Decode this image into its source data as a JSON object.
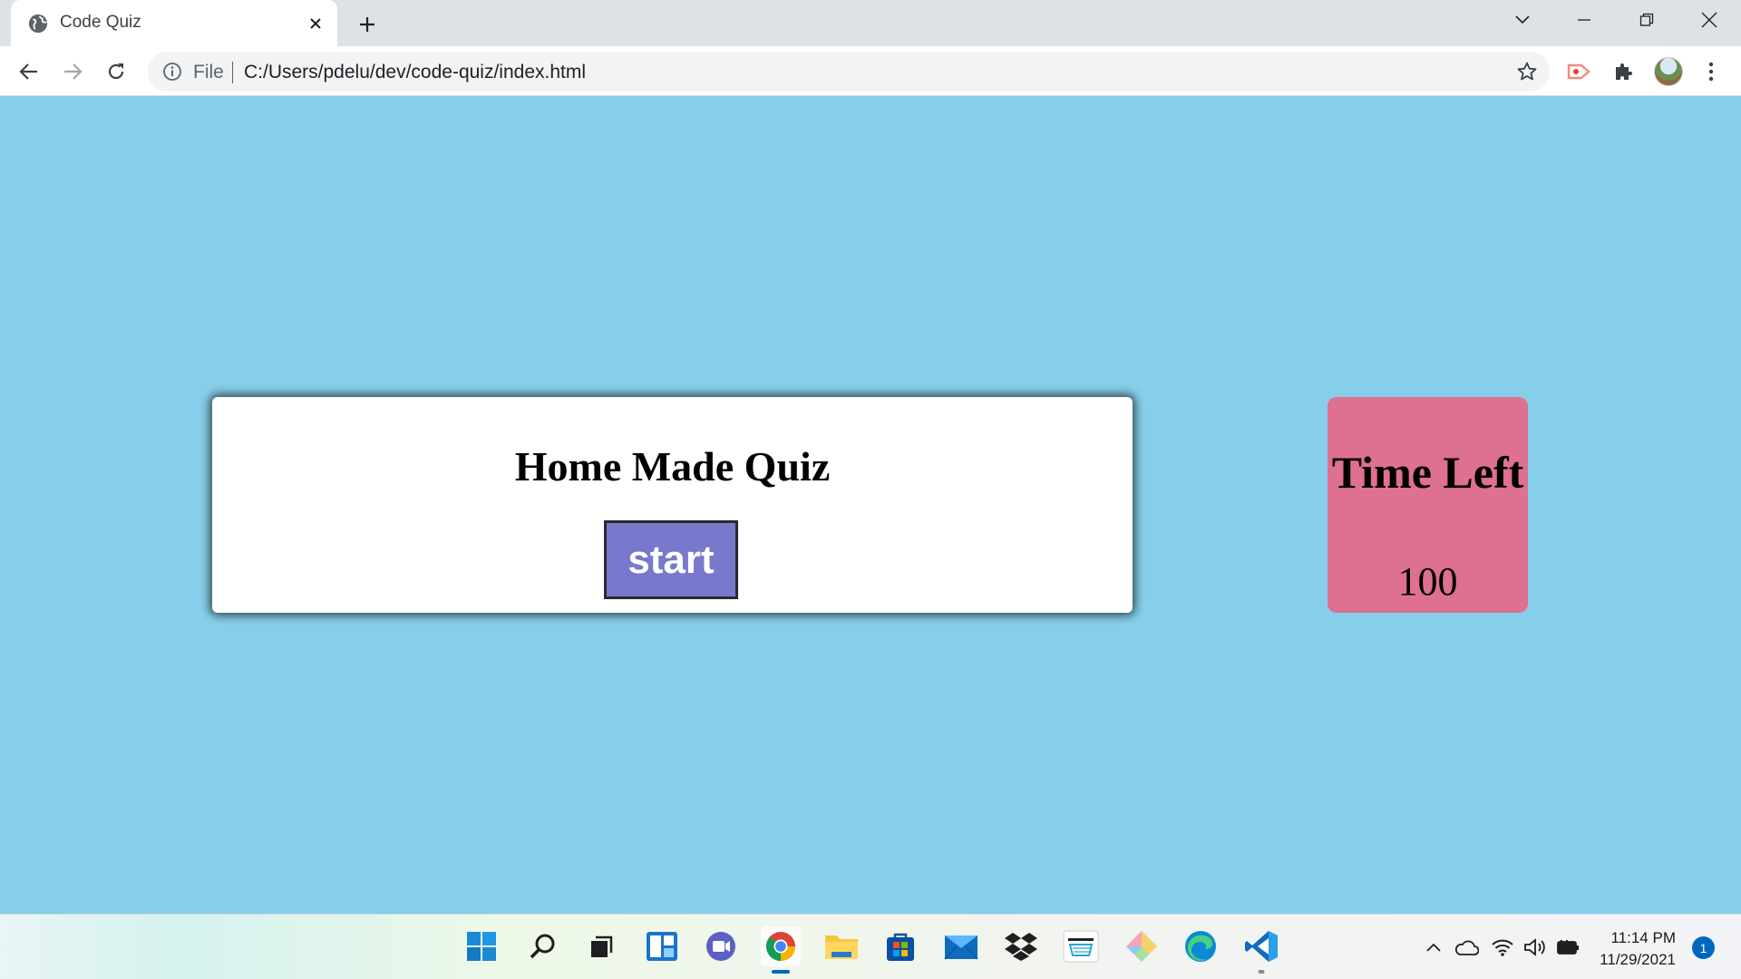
{
  "browser": {
    "tab_title": "Code Quiz",
    "address_scheme_label": "File",
    "url": "C:/Users/pdelu/dev/code-quiz/index.html"
  },
  "page": {
    "background_color": "#87ceea",
    "quiz_card": {
      "title": "Home Made Quiz",
      "start_label": "start",
      "start_button_color": "#7878cc"
    },
    "timer": {
      "title": "Time Left",
      "value": "100",
      "box_color": "#de7090"
    }
  },
  "taskbar": {
    "apps": [
      "start-icon",
      "search-icon",
      "task-view-icon",
      "widgets-icon",
      "chat-icon",
      "chrome-icon",
      "file-explorer-icon",
      "microsoft-store-icon",
      "mail-icon",
      "dropbox-icon",
      "amazon-icon",
      "git-icon",
      "edge-icon",
      "vscode-icon"
    ],
    "time": "11:14 PM",
    "date": "11/29/2021",
    "notification_count": "1"
  }
}
